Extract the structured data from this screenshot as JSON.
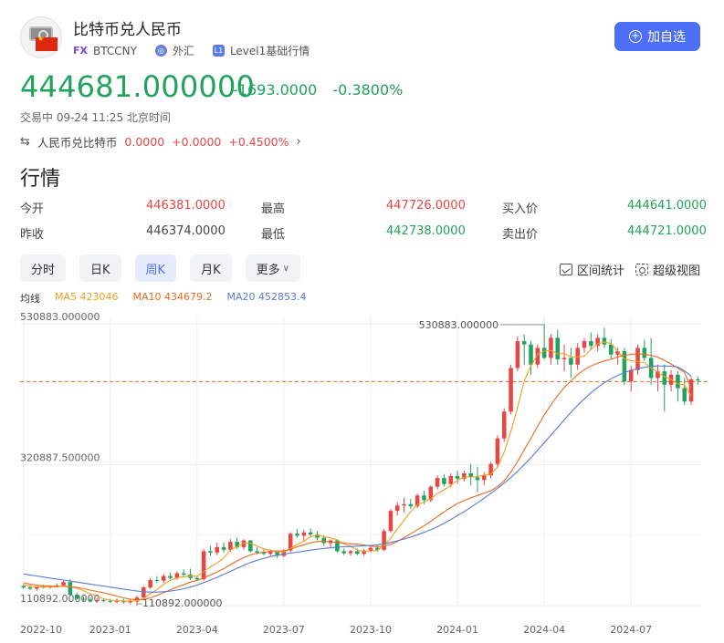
{
  "header": {
    "title": "比特币兑人民币",
    "fx_badge": "FX",
    "symbol": "BTCCNY",
    "market": "外汇",
    "level_badge": "L1",
    "level": "Level1基础行情",
    "add_button": "加自选"
  },
  "quote": {
    "price": "444681.000000",
    "change": "-1693.0000",
    "change_pct": "-0.3800%",
    "status": "交易中 09-24 11:25 北京时间"
  },
  "inverse": {
    "label": "人民币兑比特币",
    "price": "0.0000",
    "change": "+0.0000",
    "change_pct": "+0.4500%"
  },
  "section_title": "行情",
  "stats": {
    "open_label": "今开",
    "open": "446381.0000",
    "high_label": "最高",
    "high": "447726.0000",
    "bid_label": "买入价",
    "bid": "444641.0000",
    "prev_label": "昨收",
    "prev": "446374.0000",
    "low_label": "最低",
    "low": "442738.0000",
    "ask_label": "卖出价",
    "ask": "444721.0000"
  },
  "tabs": [
    "分时",
    "日K",
    "周K",
    "月K",
    "更多"
  ],
  "active_tab": "周K",
  "tools": {
    "range": "区间统计",
    "zoom": "超级视图"
  },
  "ma": {
    "title": "均线",
    "ma5": "MA5 423046",
    "ma10": "MA10 434679.2",
    "ma20": "MA20 452853.4"
  },
  "colors": {
    "up": "#e84545",
    "down": "#20a35c",
    "accent": "#4c6ff5",
    "ma5": "#f0a020",
    "ma10": "#ec6b1e",
    "ma20": "#5b7bd5"
  },
  "chart_data": {
    "type": "candlestick",
    "y_ticks": [
      "530883.000000",
      "320887.500000",
      "110892.000000"
    ],
    "y_tick_values": [
      530883,
      320887.5,
      110892
    ],
    "ylim": [
      110892,
      530883
    ],
    "x_ticks": [
      "2022-10",
      "2023-01",
      "2023-04",
      "2023-07",
      "2023-10",
      "2024-01",
      "2024-04",
      "2024-07"
    ],
    "x_tick_index": [
      0,
      13,
      26,
      39,
      52,
      65,
      78,
      91
    ],
    "annotations": [
      {
        "text": "530883.000000",
        "index": 78,
        "value": 530883
      },
      {
        "text": "110892.000000",
        "index": 17,
        "value": 110892
      }
    ],
    "last_price": 444681,
    "series": [
      {
        "name": "candles",
        "ohlc": [
          [
            140000,
            142000,
            136000,
            138000
          ],
          [
            138000,
            141000,
            134000,
            136000
          ],
          [
            136000,
            140000,
            133000,
            139000
          ],
          [
            139000,
            142000,
            137000,
            138000
          ],
          [
            138000,
            141000,
            136000,
            140000
          ],
          [
            140000,
            144000,
            138000,
            141000
          ],
          [
            141000,
            148000,
            139000,
            146000
          ],
          [
            146000,
            150000,
            125000,
            127000
          ],
          [
            127000,
            130000,
            120000,
            121000
          ],
          [
            121000,
            124000,
            117000,
            120000
          ],
          [
            120000,
            123000,
            116000,
            118000
          ],
          [
            118000,
            122000,
            115000,
            119000
          ],
          [
            119000,
            122000,
            116000,
            118000
          ],
          [
            118000,
            121000,
            115000,
            117000
          ],
          [
            117000,
            122000,
            114000,
            118000
          ],
          [
            118000,
            121000,
            114000,
            116000
          ],
          [
            116000,
            120000,
            113000,
            117000
          ],
          [
            117000,
            126000,
            110892,
            123000
          ],
          [
            123000,
            140000,
            121000,
            138000
          ],
          [
            138000,
            152000,
            136000,
            149000
          ],
          [
            149000,
            155000,
            145000,
            148000
          ],
          [
            148000,
            158000,
            145000,
            155000
          ],
          [
            155000,
            160000,
            150000,
            152000
          ],
          [
            152000,
            162000,
            149000,
            159000
          ],
          [
            159000,
            165000,
            154000,
            157000
          ],
          [
            157000,
            166000,
            149000,
            152000
          ],
          [
            152000,
            155000,
            148000,
            150000
          ],
          [
            150000,
            195000,
            148000,
            192000
          ],
          [
            192000,
            200000,
            185000,
            190000
          ],
          [
            190000,
            205000,
            186000,
            198000
          ],
          [
            198000,
            205000,
            190000,
            194000
          ],
          [
            194000,
            210000,
            191000,
            206000
          ],
          [
            206000,
            212000,
            195000,
            198000
          ],
          [
            198000,
            210000,
            194000,
            208000
          ],
          [
            208000,
            209000,
            190000,
            192000
          ],
          [
            192000,
            198000,
            187000,
            190000
          ],
          [
            190000,
            196000,
            186000,
            188000
          ],
          [
            188000,
            194000,
            185000,
            191000
          ],
          [
            191000,
            193000,
            182000,
            185000
          ],
          [
            185000,
            195000,
            183000,
            193000
          ],
          [
            193000,
            220000,
            190000,
            218000
          ],
          [
            218000,
            225000,
            212000,
            215000
          ],
          [
            215000,
            224000,
            208000,
            220000
          ],
          [
            220000,
            226000,
            214000,
            217000
          ],
          [
            217000,
            222000,
            208000,
            212000
          ],
          [
            212000,
            216000,
            200000,
            204000
          ],
          [
            204000,
            210000,
            196000,
            208000
          ],
          [
            208000,
            210000,
            190000,
            192000
          ],
          [
            192000,
            196000,
            186000,
            189000
          ],
          [
            189000,
            194000,
            185000,
            192000
          ],
          [
            192000,
            196000,
            186000,
            188000
          ],
          [
            188000,
            195000,
            185000,
            193000
          ],
          [
            193000,
            200000,
            190000,
            197000
          ],
          [
            197000,
            201000,
            191000,
            194000
          ],
          [
            194000,
            225000,
            192000,
            222000
          ],
          [
            222000,
            255000,
            220000,
            252000
          ],
          [
            252000,
            265000,
            245000,
            260000
          ],
          [
            260000,
            272000,
            250000,
            262000
          ],
          [
            262000,
            270000,
            255000,
            259000
          ],
          [
            259000,
            278000,
            256000,
            275000
          ],
          [
            275000,
            282000,
            262000,
            268000
          ],
          [
            268000,
            290000,
            265000,
            288000
          ],
          [
            288000,
            305000,
            284000,
            301000
          ],
          [
            301000,
            307000,
            288000,
            292000
          ],
          [
            292000,
            308000,
            287000,
            304000
          ],
          [
            304000,
            312000,
            293000,
            300000
          ],
          [
            300000,
            312000,
            296000,
            308000
          ],
          [
            308000,
            322000,
            290000,
            302000
          ],
          [
            302000,
            318000,
            280000,
            298000
          ],
          [
            298000,
            310000,
            290000,
            305000
          ],
          [
            305000,
            325000,
            300000,
            322000
          ],
          [
            322000,
            365000,
            318000,
            360000
          ],
          [
            360000,
            405000,
            355000,
            400000
          ],
          [
            400000,
            470000,
            396000,
            465000
          ],
          [
            465000,
            512000,
            460000,
            505000
          ],
          [
            505000,
            515000,
            470000,
            500000
          ],
          [
            500000,
            506000,
            455000,
            470000
          ],
          [
            470000,
            500000,
            465000,
            495000
          ],
          [
            495000,
            530883,
            478000,
            480000
          ],
          [
            480000,
            515000,
            470000,
            510000
          ],
          [
            510000,
            522000,
            470000,
            478000
          ],
          [
            478000,
            500000,
            460000,
            480000
          ],
          [
            480000,
            495000,
            450000,
            470000
          ],
          [
            470000,
            502000,
            462000,
            495000
          ],
          [
            495000,
            510000,
            488000,
            505000
          ],
          [
            505000,
            518000,
            492000,
            498000
          ],
          [
            498000,
            515000,
            490000,
            510000
          ],
          [
            510000,
            525000,
            495000,
            500000
          ],
          [
            500000,
            508000,
            478000,
            485000
          ],
          [
            485000,
            495000,
            470000,
            490000
          ],
          [
            490000,
            495000,
            440000,
            445000
          ],
          [
            445000,
            468000,
            430000,
            462000
          ],
          [
            462000,
            500000,
            455000,
            495000
          ],
          [
            495000,
            507000,
            475000,
            480000
          ],
          [
            480000,
            510000,
            440000,
            450000
          ],
          [
            450000,
            470000,
            430000,
            460000
          ],
          [
            460000,
            470000,
            400000,
            440000
          ],
          [
            440000,
            462000,
            430000,
            455000
          ],
          [
            455000,
            460000,
            415000,
            435000
          ],
          [
            435000,
            450000,
            410000,
            415000
          ],
          [
            415000,
            452000,
            410000,
            448000
          ],
          [
            448000,
            452000,
            440000,
            446374
          ]
        ]
      },
      {
        "name": "MA5",
        "values": [
          142000,
          140000,
          139000,
          139000,
          138500,
          139000,
          140000,
          139500,
          137000,
          133000,
          128500,
          125000,
          121000,
          119000,
          118500,
          117500,
          117500,
          118000,
          121500,
          128500,
          135000,
          142500,
          148500,
          152500,
          154000,
          155000,
          154500,
          161500,
          168500,
          174500,
          182000,
          194000,
          199000,
          204000,
          204000,
          199500,
          195500,
          193500,
          191000,
          190500,
          196000,
          202000,
          207000,
          213500,
          216000,
          213500,
          212000,
          208500,
          203000,
          199000,
          194000,
          191500,
          192500,
          193000,
          200500,
          211500,
          225000,
          238000,
          251000,
          261500,
          265000,
          270000,
          278000,
          283500,
          290000,
          297500,
          302500,
          302500,
          303000,
          305500,
          307000,
          317000,
          339500,
          370500,
          406000,
          446000,
          468000,
          485500,
          490000,
          491000,
          486000,
          486500,
          481500,
          481500,
          482500,
          493000,
          501000,
          503500,
          501500,
          490000,
          478500,
          476000,
          474500,
          473000,
          465000,
          459000,
          452000,
          448000,
          441000,
          440000,
          423046
        ]
      },
      {
        "name": "MA10",
        "values": [
          145000,
          143000,
          141500,
          140500,
          140000,
          139500,
          139500,
          139000,
          138000,
          136000,
          134000,
          132000,
          130000,
          127500,
          125000,
          122500,
          120500,
          119500,
          120000,
          122500,
          126000,
          130000,
          134500,
          138500,
          142000,
          146000,
          148500,
          152000,
          156500,
          161000,
          166000,
          172000,
          177500,
          182500,
          186500,
          189000,
          190500,
          192000,
          192500,
          192500,
          195000,
          198500,
          201500,
          204500,
          206500,
          206500,
          206000,
          205000,
          204000,
          203000,
          202500,
          201000,
          199500,
          198500,
          199500,
          202000,
          206500,
          212000,
          218000,
          224000,
          230000,
          236500,
          243500,
          250500,
          257000,
          263000,
          267500,
          271500,
          275000,
          278500,
          282000,
          288000,
          297000,
          310000,
          325500,
          343000,
          360000,
          378000,
          395000,
          410000,
          424000,
          436000,
          446000,
          455000,
          462500,
          468000,
          472000,
          475500,
          478000,
          481500,
          484000,
          485500,
          486000,
          485500,
          484000,
          481000,
          476500,
          471000,
          465000,
          458500,
          434679.2
        ]
      },
      {
        "name": "MA20",
        "values": [
          158000,
          156500,
          155000,
          153500,
          152000,
          150500,
          149000,
          147500,
          146000,
          144500,
          143000,
          141500,
          140000,
          138500,
          137000,
          135500,
          134000,
          132500,
          131500,
          131000,
          131000,
          131500,
          132500,
          134000,
          136000,
          138500,
          141500,
          145000,
          149000,
          153000,
          157500,
          162000,
          166500,
          171000,
          175000,
          178500,
          181500,
          184000,
          186000,
          187500,
          189000,
          190500,
          192000,
          193500,
          195000,
          196000,
          197000,
          198000,
          198500,
          199000,
          199500,
          200000,
          200500,
          201500,
          203000,
          205000,
          207500,
          210000,
          213000,
          216500,
          220000,
          224000,
          228500,
          233500,
          239000,
          245000,
          251000,
          257500,
          264000,
          271000,
          278000,
          285500,
          293500,
          302000,
          311000,
          321000,
          331500,
          342500,
          353500,
          365000,
          376500,
          388000,
          399000,
          409500,
          419000,
          428000,
          436000,
          443000,
          449000,
          454000,
          458000,
          461500,
          464000,
          466000,
          467500,
          468000,
          468000,
          467500,
          466500,
          461000,
          452853.4
        ]
      }
    ]
  }
}
